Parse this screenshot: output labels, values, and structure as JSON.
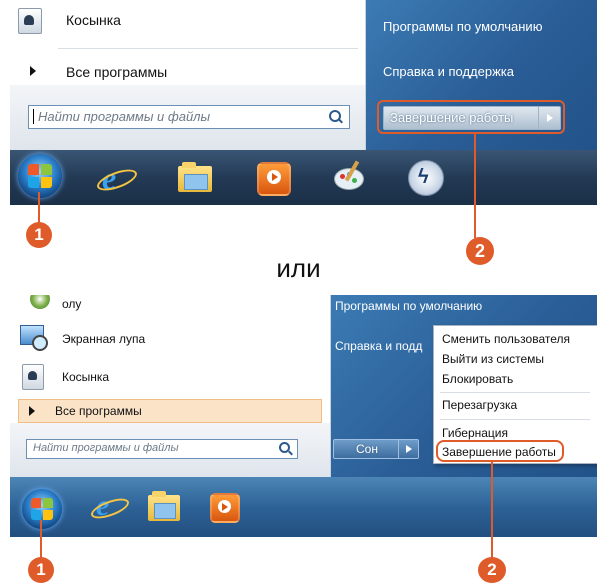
{
  "top": {
    "menu": {
      "pinned_item": "Косынка",
      "all_programs": "Все программы",
      "search_placeholder": "Найти программы и файлы"
    },
    "right": {
      "default_programs": "Программы по умолчанию",
      "help": "Справка и поддержка",
      "shutdown": "Завершение работы"
    },
    "callouts": {
      "start": "1",
      "shutdown": "2"
    }
  },
  "connector": "или",
  "bottom": {
    "menu": {
      "item_partial": "олу",
      "magnifier": "Экранная лупа",
      "solitaire": "Косынка",
      "all_programs": "Все программы",
      "search_placeholder": "Найти программы и файлы"
    },
    "right": {
      "default_programs": "Программы по умолчанию",
      "help_partial": "Справка и подд",
      "sleep": "Сон"
    },
    "submenu": {
      "switch_user": "Сменить пользователя",
      "logoff": "Выйти из системы",
      "lock": "Блокировать",
      "restart": "Перезагрузка",
      "hibernate": "Гибернация",
      "shutdown": "Завершение работы"
    },
    "callouts": {
      "start": "1",
      "shutdown": "2"
    }
  },
  "colors": {
    "accent": "#e05b2a",
    "menu_blue": "#2a5d96"
  },
  "icons": [
    "solitaire-icon",
    "windows-orb-icon",
    "internet-explorer-icon",
    "explorer-folder-icon",
    "media-player-icon",
    "paint-icon",
    "power-app-icon",
    "magnifier-icon",
    "search-icon",
    "arrow-right-icon"
  ]
}
